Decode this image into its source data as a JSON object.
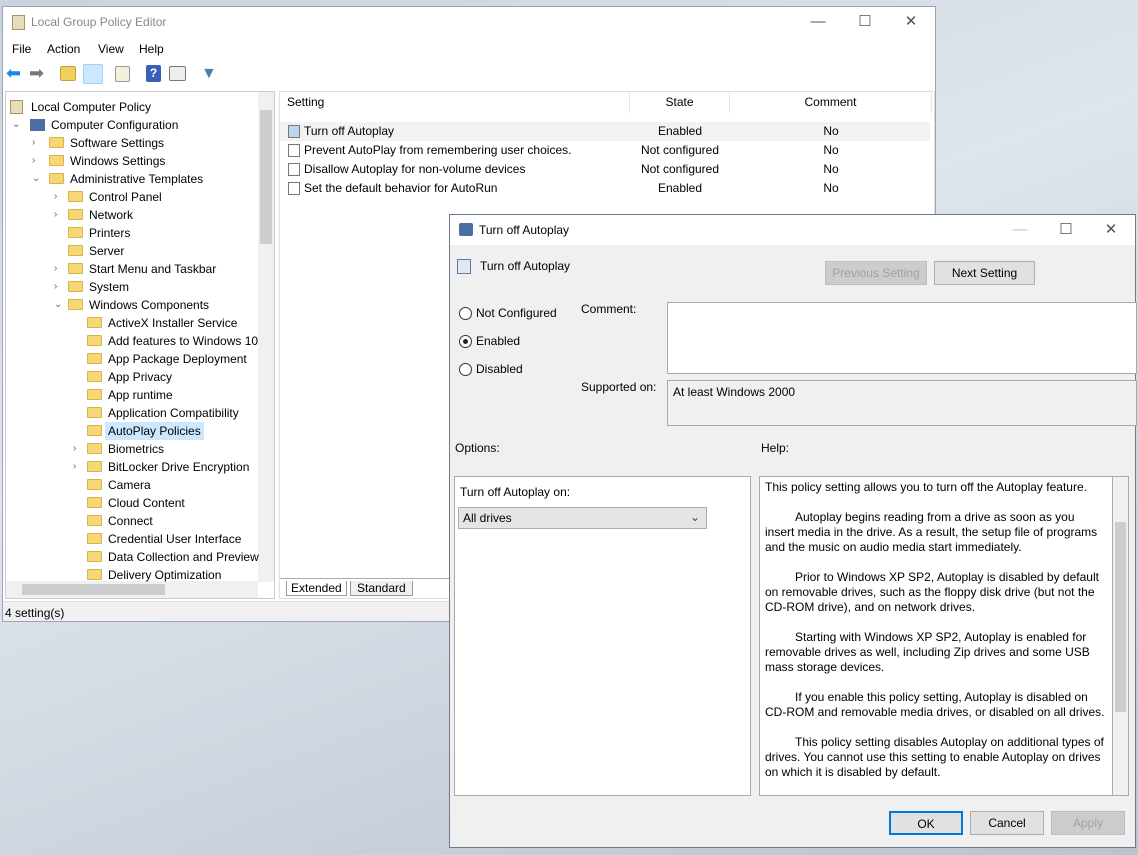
{
  "window": {
    "title": "Local Group Policy Editor",
    "minimize": "—",
    "maximize": "☐",
    "close": "✕"
  },
  "menu": [
    "File",
    "Action",
    "View",
    "Help"
  ],
  "toolbar": [
    "back-icon",
    "forward-icon",
    "up-folder-icon",
    "show-hide-tree-icon",
    "export-list-icon",
    "help-icon",
    "show-action-pane-icon",
    "filter-icon"
  ],
  "tree": [
    {
      "label": "Local Computer Policy",
      "level": 0,
      "chev": "",
      "icon": "policy"
    },
    {
      "label": "Computer Configuration",
      "level": 1,
      "chev": "v",
      "icon": "computer"
    },
    {
      "label": "Software Settings",
      "level": 2,
      "chev": ">"
    },
    {
      "label": "Windows Settings",
      "level": 2,
      "chev": ">"
    },
    {
      "label": "Administrative Templates",
      "level": 2,
      "chev": "v"
    },
    {
      "label": "Control Panel",
      "level": 3,
      "chev": ">"
    },
    {
      "label": "Network",
      "level": 3,
      "chev": ">"
    },
    {
      "label": "Printers",
      "level": 3,
      "chev": ""
    },
    {
      "label": "Server",
      "level": 3,
      "chev": ""
    },
    {
      "label": "Start Menu and Taskbar",
      "level": 3,
      "chev": ">"
    },
    {
      "label": "System",
      "level": 3,
      "chev": ">"
    },
    {
      "label": "Windows Components",
      "level": 3,
      "chev": "v"
    },
    {
      "label": "ActiveX Installer Service",
      "level": 4,
      "chev": ""
    },
    {
      "label": "Add features to Windows 10",
      "level": 4,
      "chev": ""
    },
    {
      "label": "App Package Deployment",
      "level": 4,
      "chev": ""
    },
    {
      "label": "App Privacy",
      "level": 4,
      "chev": ""
    },
    {
      "label": "App runtime",
      "level": 4,
      "chev": ""
    },
    {
      "label": "Application Compatibility",
      "level": 4,
      "chev": ""
    },
    {
      "label": "AutoPlay Policies",
      "level": 4,
      "chev": "",
      "selected": true
    },
    {
      "label": "Biometrics",
      "level": 4,
      "chev": ">"
    },
    {
      "label": "BitLocker Drive Encryption",
      "level": 4,
      "chev": ">"
    },
    {
      "label": "Camera",
      "level": 4,
      "chev": ""
    },
    {
      "label": "Cloud Content",
      "level": 4,
      "chev": ""
    },
    {
      "label": "Connect",
      "level": 4,
      "chev": ""
    },
    {
      "label": "Credential User Interface",
      "level": 4,
      "chev": ""
    },
    {
      "label": "Data Collection and Preview",
      "level": 4,
      "chev": ""
    },
    {
      "label": "Delivery Optimization",
      "level": 4,
      "chev": ""
    }
  ],
  "list": {
    "headers": [
      "Setting",
      "State",
      "Comment"
    ],
    "rows": [
      {
        "setting": "Turn off Autoplay",
        "state": "Enabled",
        "comment": "No"
      },
      {
        "setting": "Prevent AutoPlay from remembering user choices.",
        "state": "Not configured",
        "comment": "No"
      },
      {
        "setting": "Disallow Autoplay for non-volume devices",
        "state": "Not configured",
        "comment": "No"
      },
      {
        "setting": "Set the default behavior for AutoRun",
        "state": "Enabled",
        "comment": "No"
      }
    ]
  },
  "tabs": [
    "Extended",
    "Standard"
  ],
  "status": "4 setting(s)",
  "dialog": {
    "title": "Turn off Autoplay",
    "heading": "Turn off Autoplay",
    "prev": "Previous Setting",
    "next": "Next Setting",
    "radios": [
      {
        "label": "Not Configured",
        "checked": false
      },
      {
        "label": "Enabled",
        "checked": true
      },
      {
        "label": "Disabled",
        "checked": false
      }
    ],
    "comment_label": "Comment:",
    "comment_value": "",
    "supported_label": "Supported on:",
    "supported_value": "At least Windows 2000",
    "options_label": "Options:",
    "help_label": "Help:",
    "option_field_label": "Turn off Autoplay on:",
    "option_value": "All drives",
    "help": [
      "This policy setting allows you to turn off the Autoplay feature.",
      "Autoplay begins reading from a drive as soon as you insert media in the drive. As a result, the setup file of programs and the music on audio media start immediately.",
      "Prior to Windows XP SP2, Autoplay is disabled by default on removable drives, such as the floppy disk drive (but not the CD-ROM drive), and on network drives.",
      "Starting with Windows XP SP2, Autoplay is enabled for removable drives as well, including Zip drives and some USB mass storage devices.",
      "If you enable this policy setting, Autoplay is disabled on CD-ROM and removable media drives, or disabled on all drives.",
      "This policy setting disables Autoplay on additional types of drives. You cannot use this setting to enable Autoplay on drives on which it is disabled by default."
    ],
    "ok": "OK",
    "cancel": "Cancel",
    "apply": "Apply"
  }
}
